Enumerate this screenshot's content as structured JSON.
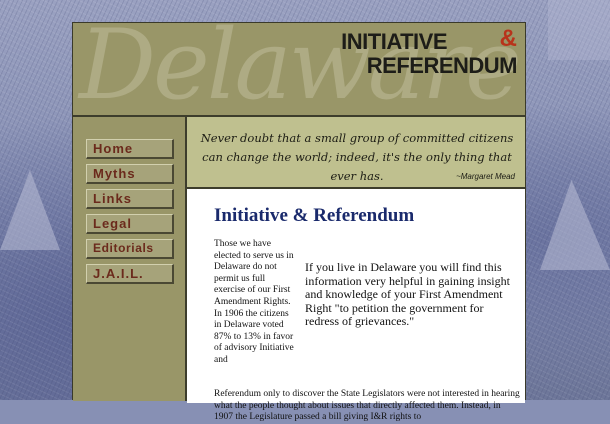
{
  "banner": {
    "script_word": "Delaware",
    "title_line1": "INITIATIVE",
    "amp": "&",
    "title_line2": "REFERENDUM"
  },
  "nav": {
    "items": [
      {
        "label": "Home"
      },
      {
        "label": "Myths"
      },
      {
        "label": "Links"
      },
      {
        "label": "Legal"
      },
      {
        "label": "Editorials"
      },
      {
        "label": "J.A.I.L."
      }
    ]
  },
  "quote": {
    "text": "Never doubt that a small group of committed citizens can change the world; indeed, it's the only thing that ever has.",
    "author": "~Margaret Mead"
  },
  "main": {
    "heading": "Initiative & Referendum",
    "left_text": "Those we have elected to serve us in Delaware do not permit us full exercise of our First Amendment Rights. In 1906 the citizens in Delaware voted 87% to 13% in favor of advisory Initiative and",
    "callout": "If you live in Delaware you will find this information very helpful in gaining insight and knowledge of your First Amendment Right \"to petition the government for redress of grievances.\"",
    "bottom_text": "Referendum only to discover the State Legislators were not interested in hearing what the people thought about issues that directly affected them. Instead, in 1907 the Legislature passed a bill giving I&R rights to"
  }
}
